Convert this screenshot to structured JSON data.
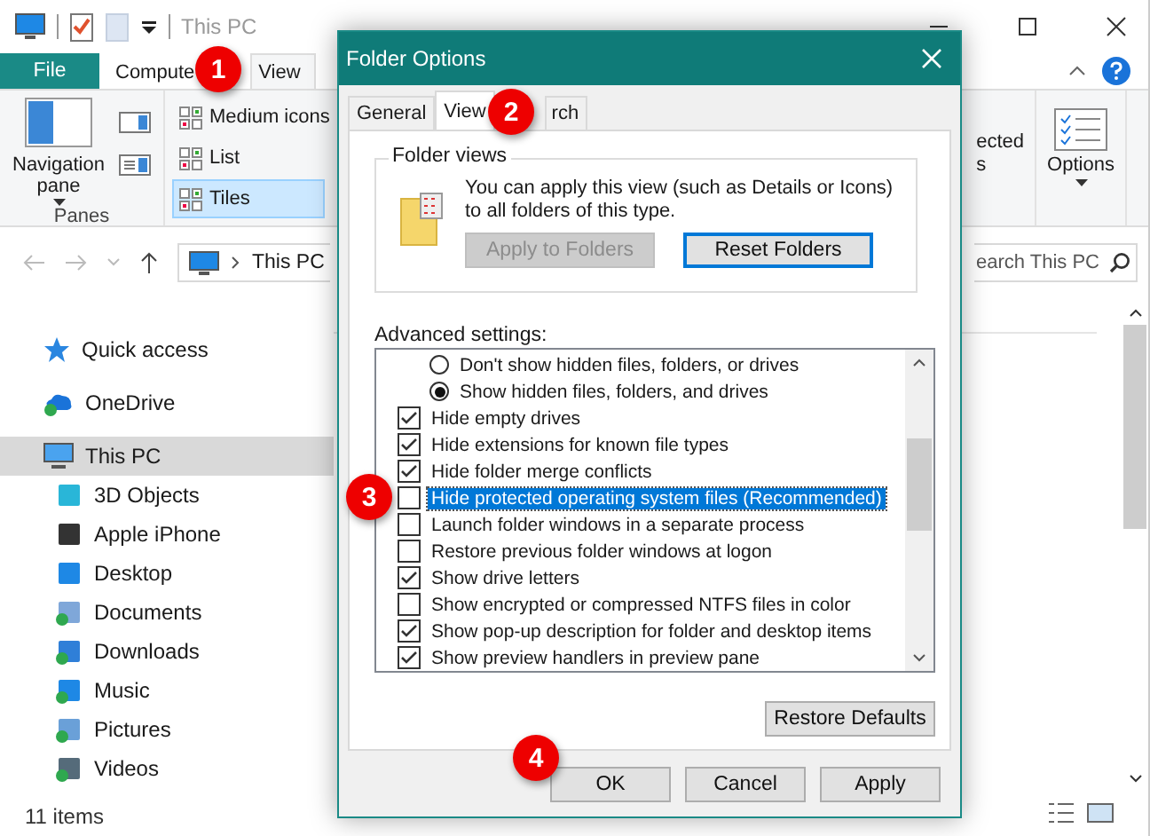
{
  "explorer": {
    "title": "This PC",
    "ribbon_tabs": [
      {
        "label": "File",
        "kind": "file",
        "selected": false
      },
      {
        "label": "Compute",
        "kind": "tab",
        "selected": false
      },
      {
        "label": "View",
        "kind": "tab",
        "selected": true
      }
    ],
    "ribbon": {
      "nav_pane_label": "Navigation pane",
      "panes_label": "Panes",
      "layouts": [
        {
          "label": "Medium icons",
          "selected": false
        },
        {
          "label": "List",
          "selected": false
        },
        {
          "label": "Tiles",
          "selected": true
        }
      ],
      "cut_label_lines": [
        "ected",
        "s"
      ],
      "options_label": "Options"
    },
    "address": {
      "crumb": "This PC"
    },
    "search": {
      "placeholder": "earch This PC"
    },
    "nav": [
      {
        "label": "Quick access",
        "selected": false
      },
      {
        "label": "OneDrive",
        "selected": false
      },
      {
        "label": "This PC",
        "selected": true,
        "children": [
          {
            "label": "3D Objects",
            "selected": false
          },
          {
            "label": "Apple iPhone",
            "selected": false
          },
          {
            "label": "Desktop",
            "selected": false
          },
          {
            "label": "Documents",
            "selected": false
          },
          {
            "label": "Downloads",
            "selected": false
          },
          {
            "label": "Music",
            "selected": false
          },
          {
            "label": "Pictures",
            "selected": false
          },
          {
            "label": "Videos",
            "selected": false
          }
        ]
      }
    ],
    "status": "11 items"
  },
  "dialog": {
    "title": "Folder Options",
    "tabs": [
      {
        "label": "General",
        "selected": false
      },
      {
        "label": "View",
        "selected": true
      },
      {
        "label": "rch",
        "selected": false
      }
    ],
    "folder_views": {
      "legend": "Folder views",
      "text": "You can apply this view (such as Details or Icons) to all folders of this type.",
      "buttons": [
        {
          "label": "Apply to Folders",
          "disabled": true,
          "focused": false
        },
        {
          "label": "Reset Folders",
          "disabled": false,
          "focused": true
        }
      ]
    },
    "advanced_label": "Advanced settings:",
    "settings": [
      {
        "kind": "radio",
        "label": "Don't show hidden files, folders, or drives",
        "checked": false,
        "selected": false
      },
      {
        "kind": "radio",
        "label": "Show hidden files, folders, and drives",
        "checked": true,
        "selected": false
      },
      {
        "kind": "checkbox",
        "label": "Hide empty drives",
        "checked": true,
        "selected": false
      },
      {
        "kind": "checkbox",
        "label": "Hide extensions for known file types",
        "checked": true,
        "selected": false
      },
      {
        "kind": "checkbox",
        "label": "Hide folder merge conflicts",
        "checked": true,
        "selected": false
      },
      {
        "kind": "checkbox",
        "label": "Hide protected operating system files (Recommended)",
        "checked": false,
        "selected": true
      },
      {
        "kind": "checkbox",
        "label": "Launch folder windows in a separate process",
        "checked": false,
        "selected": false
      },
      {
        "kind": "checkbox",
        "label": "Restore previous folder windows at logon",
        "checked": false,
        "selected": false
      },
      {
        "kind": "checkbox",
        "label": "Show drive letters",
        "checked": true,
        "selected": false
      },
      {
        "kind": "checkbox",
        "label": "Show encrypted or compressed NTFS files in color",
        "checked": false,
        "selected": false
      },
      {
        "kind": "checkbox",
        "label": "Show pop-up description for folder and desktop items",
        "checked": true,
        "selected": false
      },
      {
        "kind": "checkbox",
        "label": "Show preview handlers in preview pane",
        "checked": true,
        "selected": false
      }
    ],
    "restore_label": "Restore Defaults",
    "footer_buttons": [
      "OK",
      "Cancel",
      "Apply"
    ]
  },
  "badges": [
    "1",
    "2",
    "3",
    "4"
  ]
}
